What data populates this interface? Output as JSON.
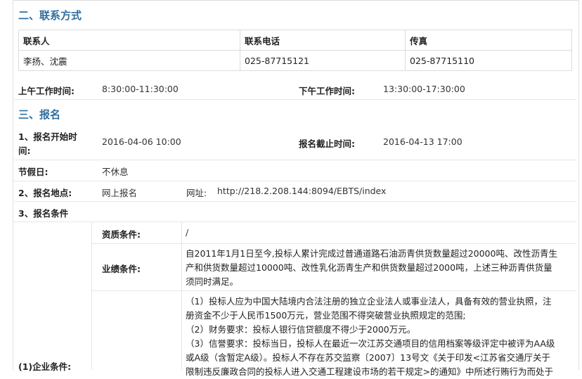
{
  "section2_title": "二、联系方式",
  "contact": {
    "headers": [
      "联系人",
      "联系电话",
      "传真"
    ],
    "values": [
      "李扬、沈震",
      "025-87715121",
      "025-87715110"
    ]
  },
  "work_time": {
    "am_label": "上午工作时间:",
    "am_value": "8:30:00-11:30:00",
    "pm_label": "下午工作时间:",
    "pm_value": "13:30:00-17:30:00"
  },
  "section3_title": "三、报名",
  "signup": {
    "start_label_line1": "1、报名开始时",
    "start_label_line2": "间:",
    "start_value": "2016-04-06 10:00",
    "deadline_label": "报名截止时间:",
    "deadline_value": "2016-04-13 17:00",
    "holiday_label": "节假日:",
    "holiday_value": "不休息",
    "place_label": "2、报名地点:",
    "place_value": "网上报名",
    "url_label": "网址:",
    "url_value": "http://218.2.208.144:8094/EBTS/index",
    "conditions_label": "3、报名条件",
    "qualification_label": "资质条件:",
    "qualification_value": "/",
    "performance_label": "业绩条件:",
    "performance_lines": [
      "自2011年1月1日至今,投标人累计完成过普通道路石油沥青供货数量超过20000吨、改性沥青生",
      "产和供货数量超过10000吨、改性乳化沥青生产和供货数量超过2000吨，上述三种沥青供货量",
      "须同时满足。"
    ],
    "enterprise_label": "(1)企业条件:",
    "enterprise_lines": [
      "（1）投标人应为中国大陆境内合法注册的独立企业法人或事业法人，具备有效的营业执照，注",
      "册资金不少于人民币1500万元，营业范围不得突破营业执照规定的范围;",
      "（2）财务要求：投标人银行信贷额度不得少于2000万元。",
      "（3）信誉要求：投标当日，投标人在最近一次江苏交通项目的信用档案等级评定中被评为AA级",
      "或A级（含暂定A级）。投标人不存在苏交监察〔2007〕13号文《关于印发<江苏省交通厅关于",
      "限制违反廉政合同的投标人进入交通工程建设市场的若干规定>的通知》中所述行贿行为而处于"
    ]
  }
}
